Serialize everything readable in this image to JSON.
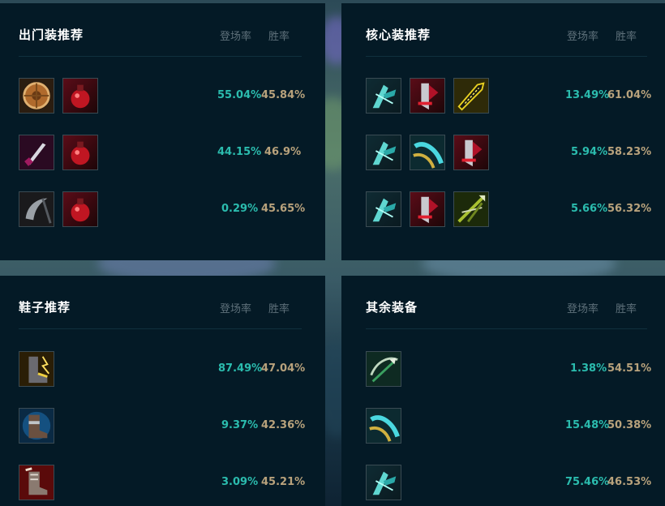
{
  "colors": {
    "panel_bg": "#041a26",
    "pick_rate": "#2bbcae",
    "win_rate": "#b8a27c",
    "header_muted": "#5e707a"
  },
  "panels": {
    "starting": {
      "title": "出门装推荐",
      "col_pick": "登场率",
      "col_win": "胜率",
      "rows": [
        {
          "items": [
            "shield-item-icon",
            "health-potion-icon"
          ],
          "pick": "55.04%",
          "win": "45.84%"
        },
        {
          "items": [
            "dagger-item-icon",
            "health-potion-icon"
          ],
          "pick": "44.15%",
          "win": "46.9%"
        },
        {
          "items": [
            "scythe-item-icon",
            "health-potion-icon"
          ],
          "pick": "0.29%",
          "win": "45.65%"
        }
      ]
    },
    "core": {
      "title": "核心装推荐",
      "col_pick": "登场率",
      "col_win": "胜率",
      "rows": [
        {
          "items": [
            "cyan-blade-item-icon",
            "red-blade-item-icon",
            "gold-sword-item-icon"
          ],
          "pick": "13.49%",
          "win": "61.04%"
        },
        {
          "items": [
            "cyan-blade-item-icon",
            "cyan-bow-item-icon",
            "red-blade-item-icon"
          ],
          "pick": "5.94%",
          "win": "58.23%"
        },
        {
          "items": [
            "cyan-blade-item-icon",
            "red-blade-item-icon",
            "green-arrow-item-icon"
          ],
          "pick": "5.66%",
          "win": "56.32%"
        }
      ]
    },
    "boots": {
      "title": "鞋子推荐",
      "col_pick": "登场率",
      "col_win": "胜率",
      "rows": [
        {
          "items": [
            "gold-boots-icon"
          ],
          "pick": "87.49%",
          "win": "47.04%"
        },
        {
          "items": [
            "blue-boots-icon"
          ],
          "pick": "9.37%",
          "win": "42.36%"
        },
        {
          "items": [
            "red-boots-icon"
          ],
          "pick": "3.09%",
          "win": "45.21%"
        }
      ]
    },
    "other": {
      "title": "其余装备",
      "col_pick": "登场率",
      "col_win": "胜率",
      "rows": [
        {
          "items": [
            "green-bow-item-icon"
          ],
          "pick": "1.38%",
          "win": "54.51%"
        },
        {
          "items": [
            "cyan-bow-item-icon"
          ],
          "pick": "15.48%",
          "win": "50.38%"
        },
        {
          "items": [
            "cyan-blade-item-icon"
          ],
          "pick": "75.46%",
          "win": "46.53%"
        }
      ]
    }
  }
}
